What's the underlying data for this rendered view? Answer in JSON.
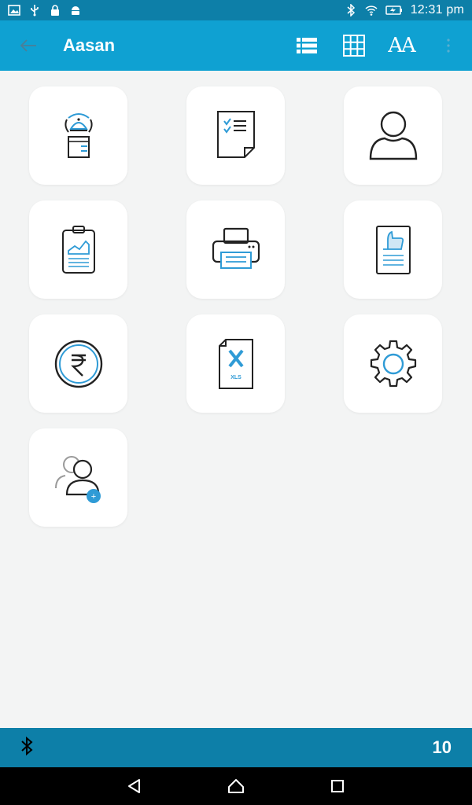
{
  "status_bar": {
    "time": "12:31 pm",
    "left_icons": [
      "image-icon",
      "usb-icon",
      "lock-icon",
      "android-icon"
    ],
    "right_icons": [
      "bluetooth-icon",
      "wifi-icon",
      "battery-charging-icon"
    ]
  },
  "app_bar": {
    "title": "Aasan",
    "actions": [
      "list-view-icon",
      "grid-view-icon",
      "font-size-icon",
      "overflow-menu-icon"
    ],
    "font_button_label": "AA"
  },
  "tiles": [
    {
      "id": "attendance",
      "icon": "attendant-icon"
    },
    {
      "id": "checklist",
      "icon": "checklist-icon"
    },
    {
      "id": "profile",
      "icon": "user-icon"
    },
    {
      "id": "report",
      "icon": "clipboard-chart-icon"
    },
    {
      "id": "print",
      "icon": "printer-icon"
    },
    {
      "id": "feedback",
      "icon": "thumbs-up-document-icon"
    },
    {
      "id": "payment",
      "icon": "rupee-coin-icon"
    },
    {
      "id": "export",
      "icon": "xls-file-icon",
      "label": "XLS"
    },
    {
      "id": "settings",
      "icon": "gear-icon"
    },
    {
      "id": "add-users",
      "icon": "add-users-icon",
      "badge": "+"
    }
  ],
  "bottom_bar": {
    "icon": "bluetooth-icon",
    "count": "10"
  },
  "nav_bar": {
    "buttons": [
      "back-triangle-icon",
      "home-icon",
      "recents-square-icon"
    ]
  },
  "colors": {
    "status_bar": "#0d7fa8",
    "app_bar": "#0fa1d2",
    "accent": "#2f9bd6",
    "background": "#f3f4f4"
  }
}
